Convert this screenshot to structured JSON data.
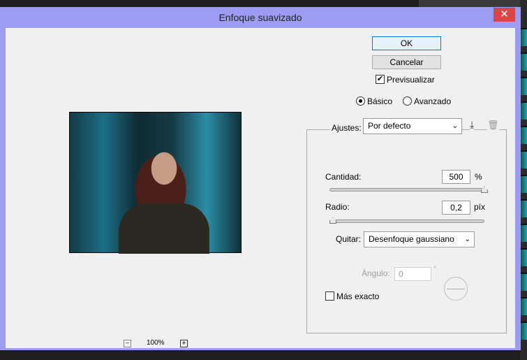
{
  "dialog": {
    "title": "Enfoque suavizado",
    "close_glyph": "✕"
  },
  "buttons": {
    "ok": "OK",
    "cancel": "Cancelar"
  },
  "preview_checkbox": {
    "label": "Previsualizar",
    "checked": true
  },
  "mode": {
    "basic": "Básico",
    "advanced": "Avanzado",
    "selected": "basic"
  },
  "settings": {
    "label": "Ajustes:",
    "value": "Por defecto"
  },
  "amount": {
    "label": "Cantidad:",
    "value": "500",
    "unit": "%",
    "slider_fraction": 1.0
  },
  "radius": {
    "label": "Radio:",
    "value": "0,2",
    "unit": "píx",
    "slider_fraction": 0.0
  },
  "remove": {
    "label": "Quitar:",
    "value": "Desenfoque gaussiano"
  },
  "angle": {
    "label": "Ángulo:",
    "value": "0",
    "unit": "°"
  },
  "more_accurate": {
    "label": "Más exacto",
    "checked": false
  },
  "zoom": {
    "level": "100%",
    "minus": "−",
    "plus": "+"
  }
}
